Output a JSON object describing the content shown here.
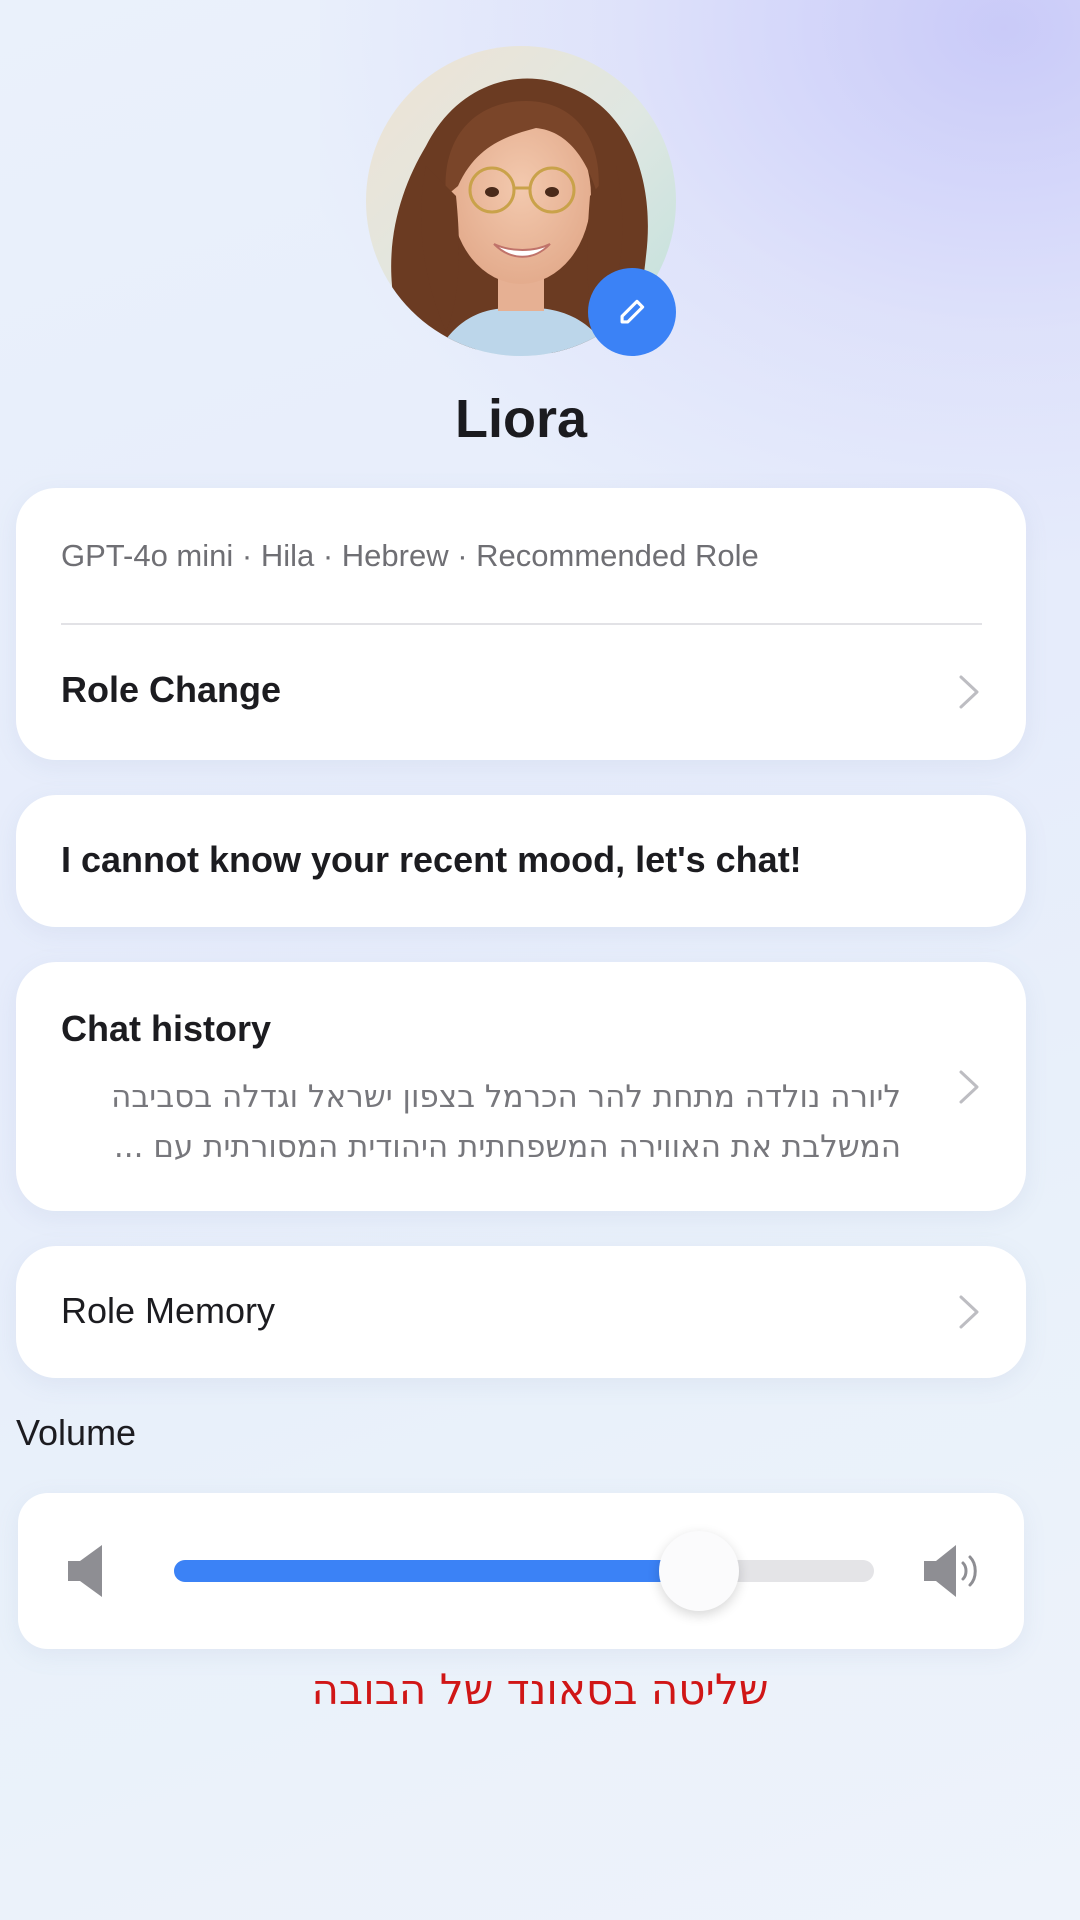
{
  "profile": {
    "name": "Liora",
    "avatar_alt": "profile photo"
  },
  "role_card": {
    "meta": "GPT-4o mini · Hila · Hebrew · Recommended Role",
    "role_change_label": "Role Change"
  },
  "mood_card": {
    "text": "I cannot know your recent mood, let's chat!"
  },
  "history_card": {
    "title": "Chat history",
    "preview_line1": "ליורה נולדה מתחת להר הכרמל בצפון ישראל וגדלה בסביבה",
    "preview_line2": "המשלבת את האווירה המשפחתית היהודית המסורתית עם ..."
  },
  "memory_card": {
    "label": "Role Memory"
  },
  "volume": {
    "label": "Volume",
    "level": 0.75
  },
  "caption": "שליטה בסאונד של הבובה",
  "colors": {
    "accent": "#3b82f6",
    "caption": "#d01616"
  }
}
